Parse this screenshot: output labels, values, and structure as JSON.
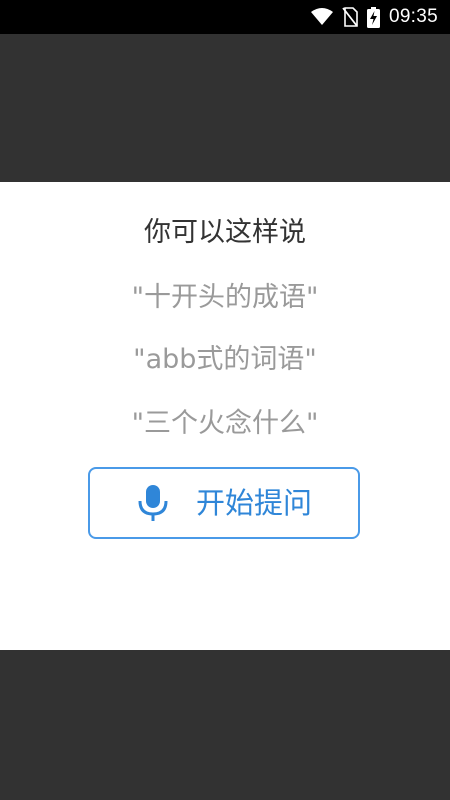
{
  "status_bar": {
    "time": "09:35",
    "icons": [
      "wifi-icon",
      "no-sim-icon",
      "battery-charging-icon"
    ]
  },
  "dialog": {
    "title": "你可以这样说",
    "suggestions": [
      "\"十开头的成语\"",
      "\"abb式的词语\"",
      "\"三个火念什么\""
    ],
    "ask_button": {
      "label": "开始提问",
      "icon": "microphone-icon"
    }
  },
  "colors": {
    "accent": "#4a9ae8",
    "overlay": "#323232",
    "suggestion_text": "#9a9a9a",
    "title_text": "#333333"
  }
}
